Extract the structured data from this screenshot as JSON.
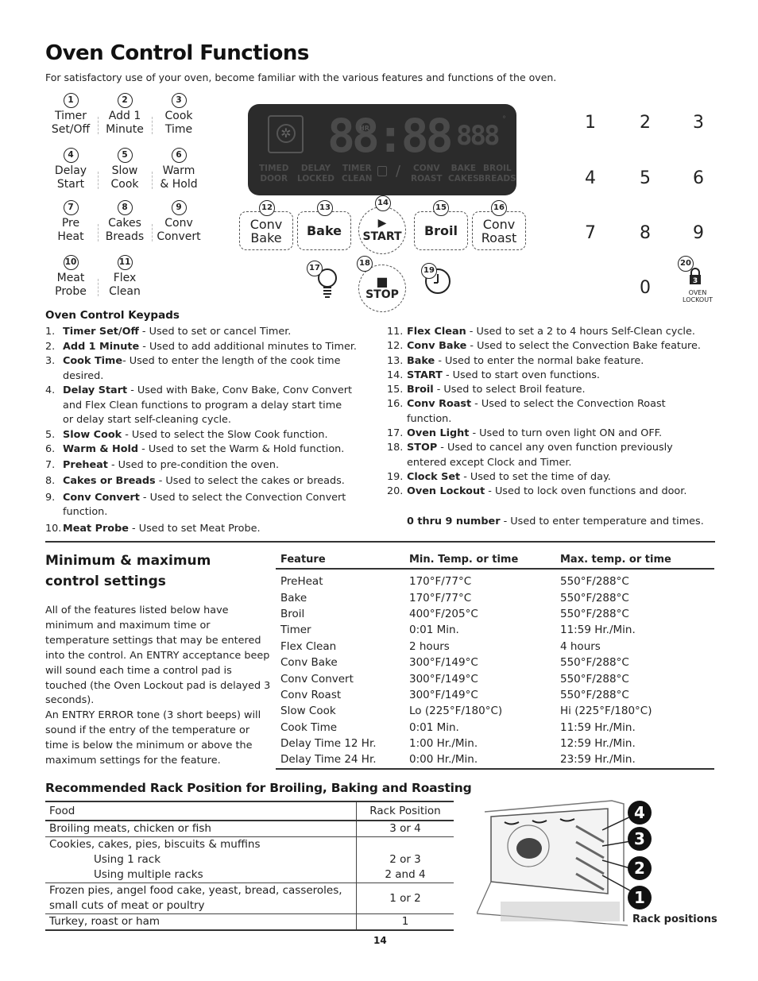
{
  "title": "Oven Control Functions",
  "intro": "For satisfactory use of your oven, become familiar with the various features and functions of the oven.",
  "keypads": [
    {
      "num": "1",
      "line1": "Timer",
      "line2": "Set/Off"
    },
    {
      "num": "2",
      "line1": "Add 1",
      "line2": "Minute"
    },
    {
      "num": "3",
      "line1": "Cook",
      "line2": "Time"
    },
    {
      "num": "4",
      "line1": "Delay",
      "line2": "Start"
    },
    {
      "num": "5",
      "line1": "Slow",
      "line2": "Cook"
    },
    {
      "num": "6",
      "line1": "Warm",
      "line2": "& Hold"
    },
    {
      "num": "7",
      "line1": "Pre",
      "line2": "Heat"
    },
    {
      "num": "8",
      "line1": "Cakes",
      "line2": "Breads"
    },
    {
      "num": "9",
      "line1": "Conv",
      "line2": "Convert"
    },
    {
      "num": "10",
      "line1": "Meat",
      "line2": "Probe"
    },
    {
      "num": "11",
      "line1": "Flex",
      "line2": "Clean"
    }
  ],
  "display": {
    "digits": "88:88",
    "hr_label": "HR",
    "small_digits": "888",
    "degree": "°",
    "indicators": [
      {
        "top": "TIMED",
        "bottom": "DOOR"
      },
      {
        "top": "DELAY",
        "bottom": "LOCKED"
      },
      {
        "top": "TIMER",
        "bottom": "CLEAN"
      },
      {
        "top": "CONV",
        "bottom": "ROAST"
      },
      {
        "top": "BAKE",
        "bottom": "CAKES"
      },
      {
        "top": "BROIL",
        "bottom": "BREADS"
      }
    ]
  },
  "pads": {
    "conv_bake": {
      "num": "12",
      "line1": "Conv",
      "line2": "Bake"
    },
    "bake": {
      "num": "13",
      "label": "Bake"
    },
    "start": {
      "num": "14",
      "icon": "▶",
      "label": "START"
    },
    "broil": {
      "num": "15",
      "label": "Broil"
    },
    "conv_roast": {
      "num": "16",
      "line1": "Conv",
      "line2": "Roast"
    },
    "light": {
      "num": "17"
    },
    "stop": {
      "num": "18",
      "icon": "■",
      "label": "STOP"
    },
    "clock": {
      "num": "19"
    },
    "lockout": {
      "num": "20",
      "line1": "OVEN",
      "line2": "LOCKOUT",
      "icon_digit": "3"
    }
  },
  "numpad": [
    "1",
    "2",
    "3",
    "4",
    "5",
    "6",
    "7",
    "8",
    "9",
    "0"
  ],
  "keypads_heading": "Oven Control Keypads",
  "descriptions_left": [
    {
      "n": "1.",
      "term": "Timer Set/Off",
      "text": " - Used to set or cancel Timer."
    },
    {
      "n": "2.",
      "term": "Add 1 Minute",
      "text": " - Used to add additional minutes to Timer."
    },
    {
      "n": "3.",
      "term": "Cook Time",
      "text": "- Used to enter the length of the cook time",
      "cont": "desired."
    },
    {
      "n": "4.",
      "term": "Delay Start",
      "text": " - Used with Bake, Conv Bake, Conv Convert",
      "cont": "and Flex Clean functions to program a delay start time",
      "cont2": "or delay start self-cleaning cycle."
    },
    {
      "n": "5.",
      "term": "Slow Cook",
      "text": " - Used to select the Slow Cook function."
    },
    {
      "n": "6.",
      "term": "Warm & Hold",
      "text": " - Used to set the Warm & Hold function."
    },
    {
      "n": "7.",
      "term": "Preheat",
      "text": " - Used to pre-condition the oven."
    },
    {
      "n": "8.",
      "term": "Cakes or Breads",
      "text": " - Used to select the cakes or breads."
    },
    {
      "n": "9.",
      "term": "Conv Convert",
      "text": " - Used to select the Convection Convert",
      "cont": "function."
    },
    {
      "n": "10.",
      "term": "Meat Probe",
      "text": " - Used to set Meat Probe."
    }
  ],
  "descriptions_right": [
    {
      "n": "11.",
      "term": "Flex Clean",
      "text": " - Used to set a 2 to 4 hours Self-Clean cycle."
    },
    {
      "n": "12.",
      "term": "Conv Bake",
      "text": " - Used to select the Convection Bake feature."
    },
    {
      "n": "13.",
      "term": "Bake",
      "text": " - Used to enter the normal bake feature."
    },
    {
      "n": "14.",
      "term": "START",
      "text": " - Used to start oven functions."
    },
    {
      "n": "15.",
      "term": "Broil",
      "text": " - Used to select Broil feature."
    },
    {
      "n": "16.",
      "term": "Conv Roast",
      "text": " - Used to select the Convection Roast",
      "cont": "function."
    },
    {
      "n": "17.",
      "term": "Oven Light",
      "text": " - Used to turn oven light ON and OFF."
    },
    {
      "n": "18.",
      "term": "STOP",
      "text": " - Used to cancel any oven function previously",
      "cont": "entered except Clock and Timer."
    },
    {
      "n": "19.",
      "term": "Clock Set",
      "text": " - Used to set the time of day."
    },
    {
      "n": "20.",
      "term": "Oven Lockout",
      "text": " - Used to lock oven functions and door."
    }
  ],
  "numbers_note": {
    "term": "0 thru 9 number",
    "text": " - Used to enter temperature and times."
  },
  "minmax": {
    "heading": "Minimum & maximum control settings",
    "text1": "All of the features listed below have minimum and maximum time or temperature settings that may be entered into the control. An ENTRY acceptance beep will sound each time a control pad is touched (the Oven Lockout pad is delayed 3 seconds).",
    "text2": "An ENTRY ERROR tone (3 short beeps) will sound if the entry of the temperature or time is below the minimum or above the maximum settings for the feature.",
    "columns": [
      "Feature",
      "Min. Temp. or time",
      "Max. temp. or time"
    ],
    "rows": [
      [
        "PreHeat",
        "170°F/77°C",
        "550°F/288°C"
      ],
      [
        "Bake",
        "170°F/77°C",
        "550°F/288°C"
      ],
      [
        "Broil",
        "400°F/205°C",
        "550°F/288°C"
      ],
      [
        "Timer",
        "0:01 Min.",
        "11:59 Hr./Min."
      ],
      [
        "Flex Clean",
        "2 hours",
        "4 hours"
      ],
      [
        "Conv Bake",
        "300°F/149°C",
        "550°F/288°C"
      ],
      [
        "Conv Convert",
        "300°F/149°C",
        "550°F/288°C"
      ],
      [
        "Conv Roast",
        "300°F/149°C",
        "550°F/288°C"
      ],
      [
        "Slow Cook",
        "Lo (225°F/180°C)",
        "Hi (225°F/180°C)"
      ],
      [
        "Cook Time",
        "0:01 Min.",
        "11:59 Hr./Min."
      ],
      [
        "Delay Time 12 Hr.",
        "1:00 Hr./Min.",
        "12:59 Hr./Min."
      ],
      [
        "Delay Time 24 Hr.",
        "0:00 Hr./Min.",
        "23:59 Hr./Min."
      ]
    ]
  },
  "rack": {
    "heading": "Recommended Rack Position for Broiling, Baking and Roasting",
    "columns": [
      "Food",
      "Rack Position"
    ],
    "rows": [
      {
        "food": "Broiling meats, chicken or fish",
        "pos": "3 or 4"
      },
      {
        "food": "Cookies, cakes, pies, biscuits & muffins",
        "sub": [
          {
            "food": "Using 1 rack",
            "pos": "2 or 3"
          },
          {
            "food": "Using multiple racks",
            "pos": "2 and 4"
          }
        ]
      },
      {
        "food": "Frozen pies, angel food cake, yeast, bread, casseroles,",
        "food2": "small cuts of meat or poultry",
        "pos": "1 or 2"
      },
      {
        "food": "Turkey, roast or ham",
        "pos": "1"
      }
    ],
    "positions": [
      "4",
      "3",
      "2",
      "1"
    ],
    "caption": "Rack positions"
  },
  "page_number": "14"
}
